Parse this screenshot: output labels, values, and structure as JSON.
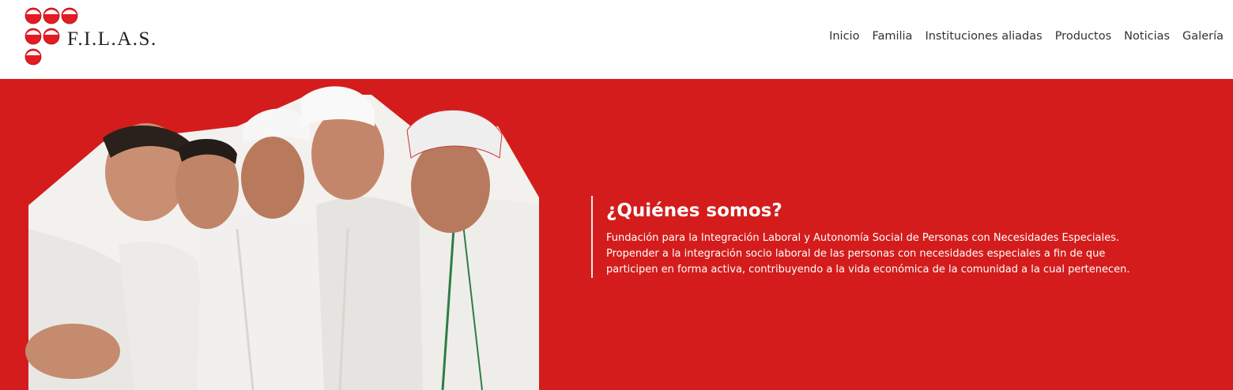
{
  "header": {
    "logo": {
      "text": "F.I.L.A.S.",
      "mark_color": "#e31b23"
    },
    "nav": {
      "items": [
        {
          "label": "Inicio"
        },
        {
          "label": "Familia"
        },
        {
          "label": "Instituciones aliadas"
        },
        {
          "label": "Productos"
        },
        {
          "label": "Noticias"
        },
        {
          "label": "Galería"
        }
      ]
    }
  },
  "hero": {
    "background_color": "#d41c1c",
    "title": "¿Quiénes somos?",
    "description_lines": [
      "Fundación para la Integración Laboral y Autonomía Social de Personas con Necesidades Especiales.",
      "Propender a la integración socio laboral de las personas con necesidades especiales a fin de que",
      "participen en forma activa, contribuyendo a la vida económica de la comunidad a la cual pertenecen."
    ]
  }
}
